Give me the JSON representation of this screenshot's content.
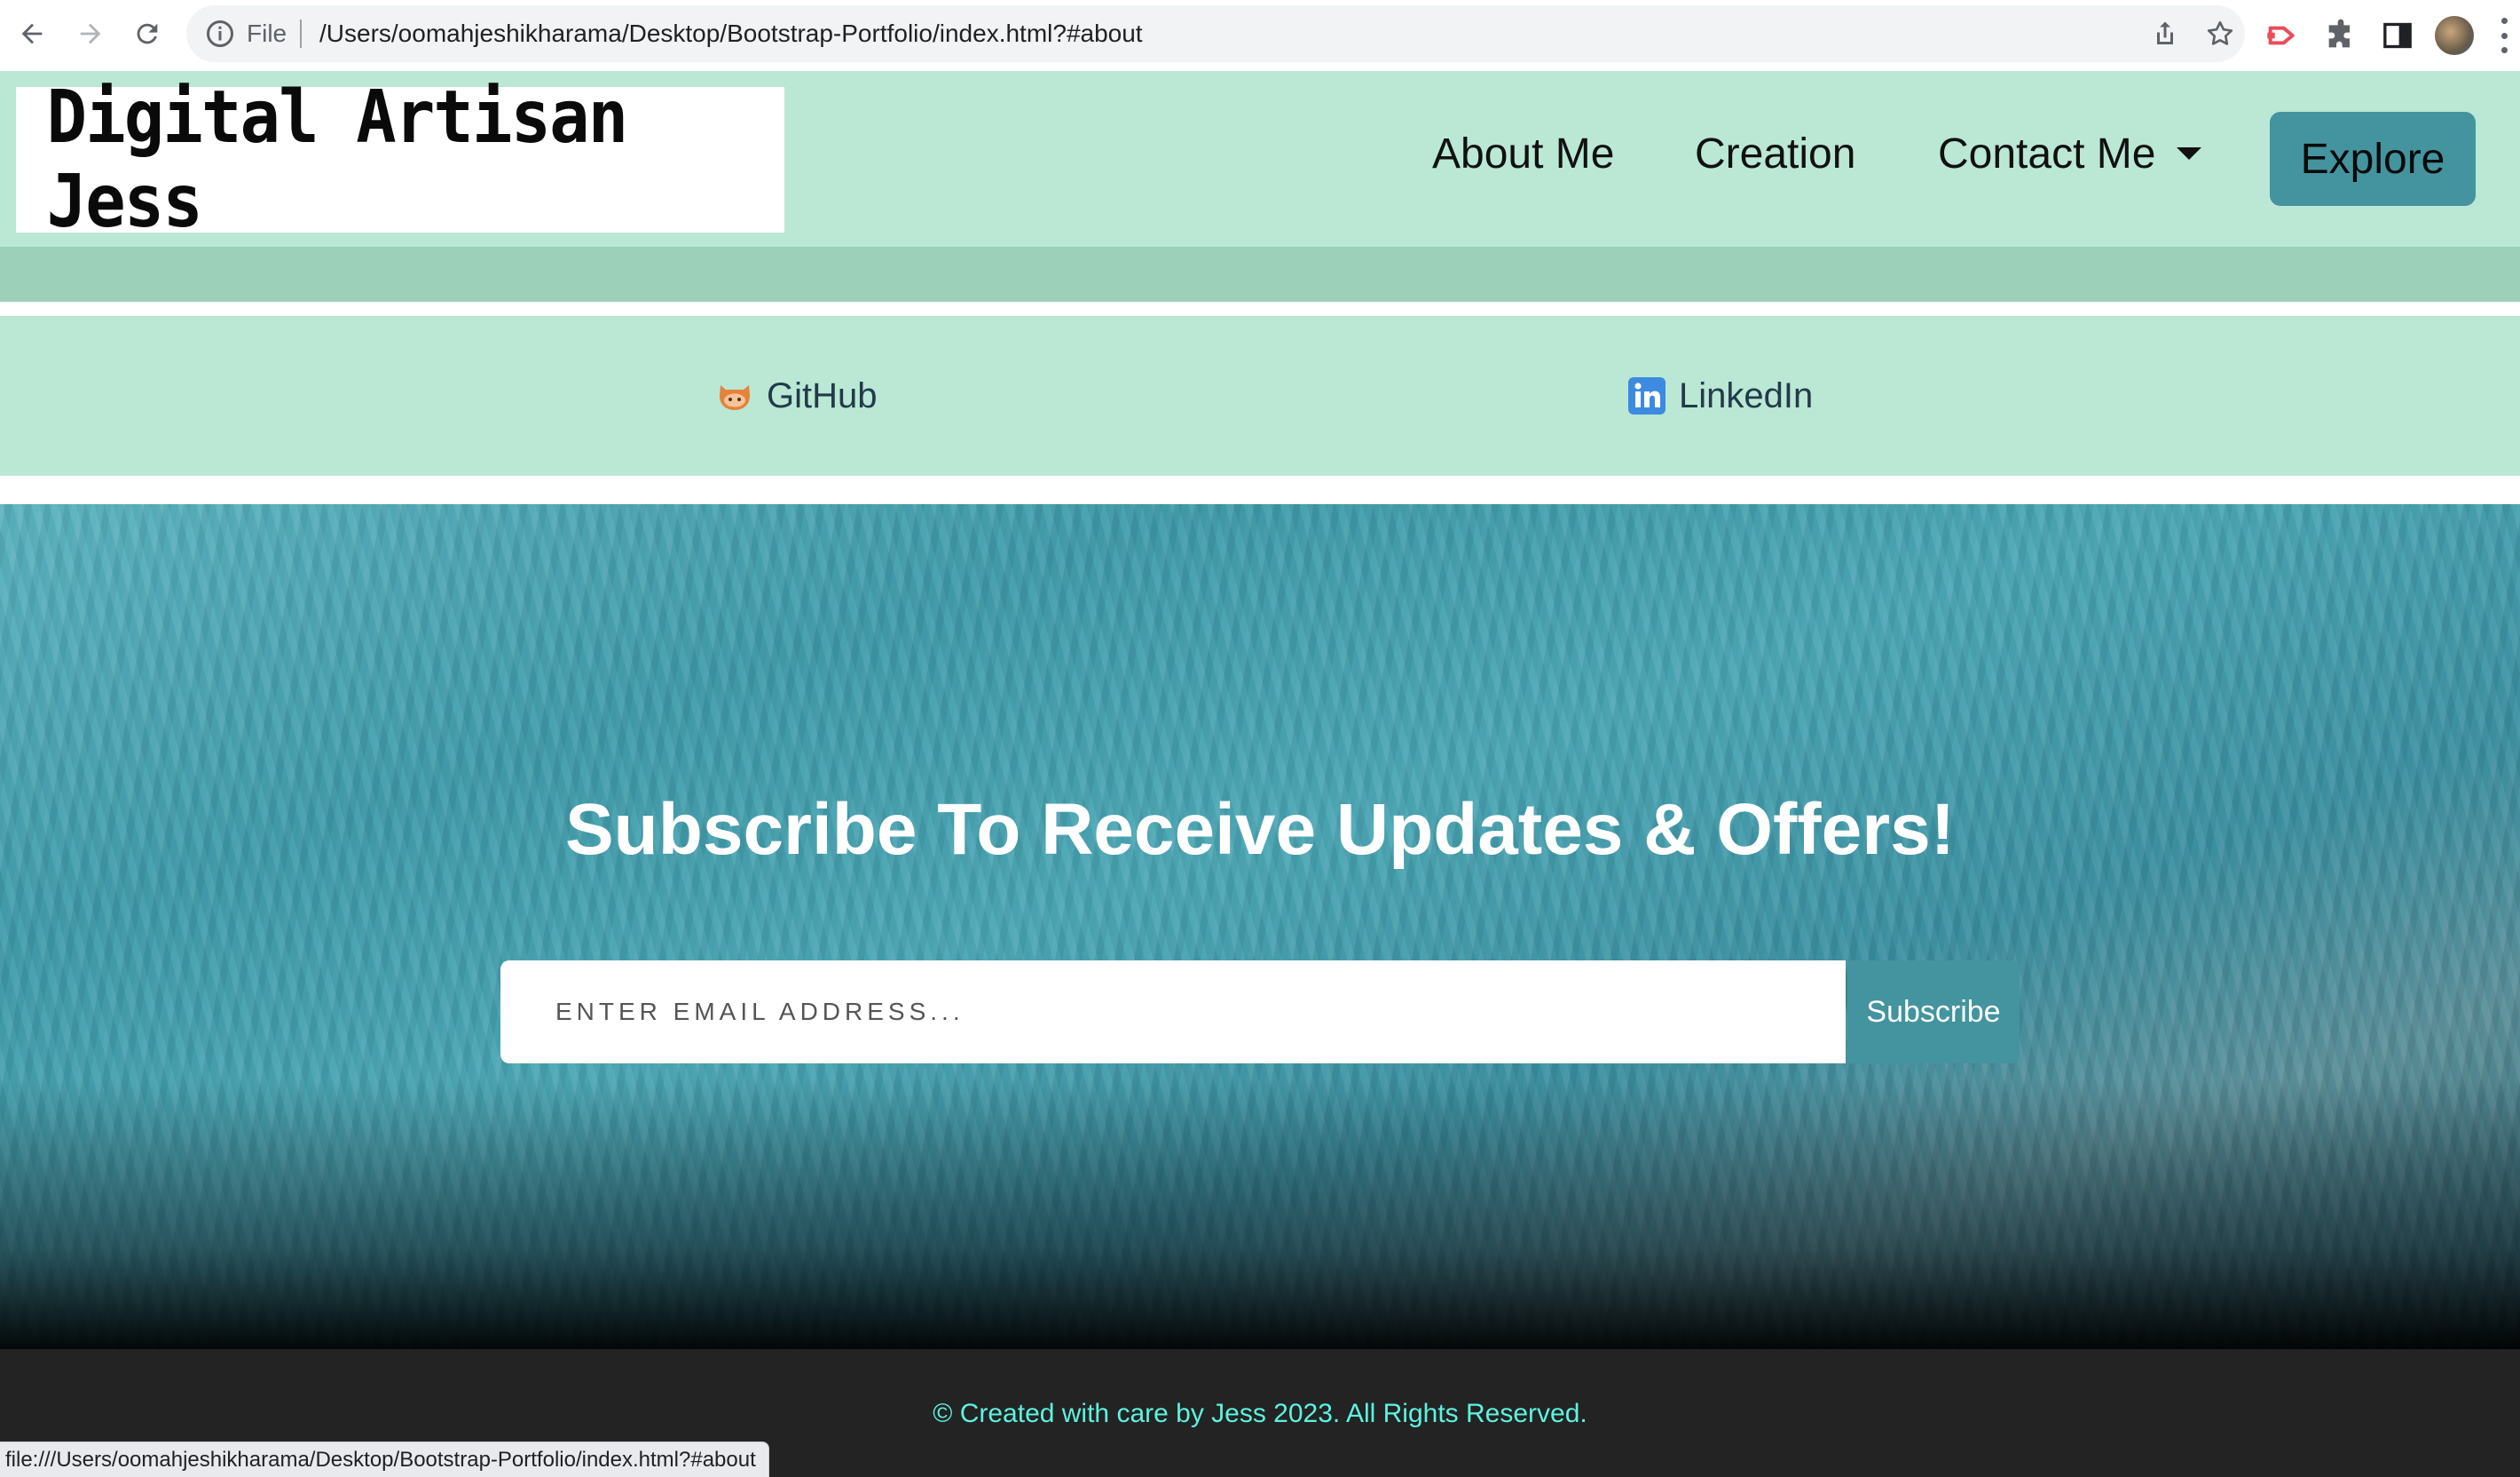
{
  "browser": {
    "omnibox_scheme_label": "File",
    "url": "/Users/oomahjeshikharama/Desktop/Bootstrap-Portfolio/index.html?#about",
    "status_url": "file:///Users/oomahjeshikharama/Desktop/Bootstrap-Portfolio/index.html?#about",
    "icons": [
      "back-icon",
      "forward-icon",
      "reload-icon",
      "info-icon",
      "share-icon",
      "bookmark-star-icon",
      "extension-red-icon",
      "puzzle-extensions-icon",
      "side-panel-icon",
      "profile-avatar",
      "kebab-menu-icon"
    ]
  },
  "navbar": {
    "brand": "Digital Artisan Jess",
    "links": {
      "about": "About Me",
      "creation": "Creation",
      "contact": "Contact Me"
    },
    "explore_label": "Explore"
  },
  "social": {
    "github_label": "GitHub",
    "linkedin_label": "LinkedIn"
  },
  "subscribe": {
    "title": "Subscribe To Receive Updates & Offers!",
    "email_placeholder": "ENTER EMAIL ADDRESS...",
    "button_label": "Subscribe"
  },
  "footer": {
    "text": "© Created with care by Jess 2023. All Rights Reserved."
  },
  "colors": {
    "nav_bg": "#bae8d4",
    "accent": "#43949e",
    "footer_bg": "#232323",
    "footer_text": "#5ef2e0"
  }
}
